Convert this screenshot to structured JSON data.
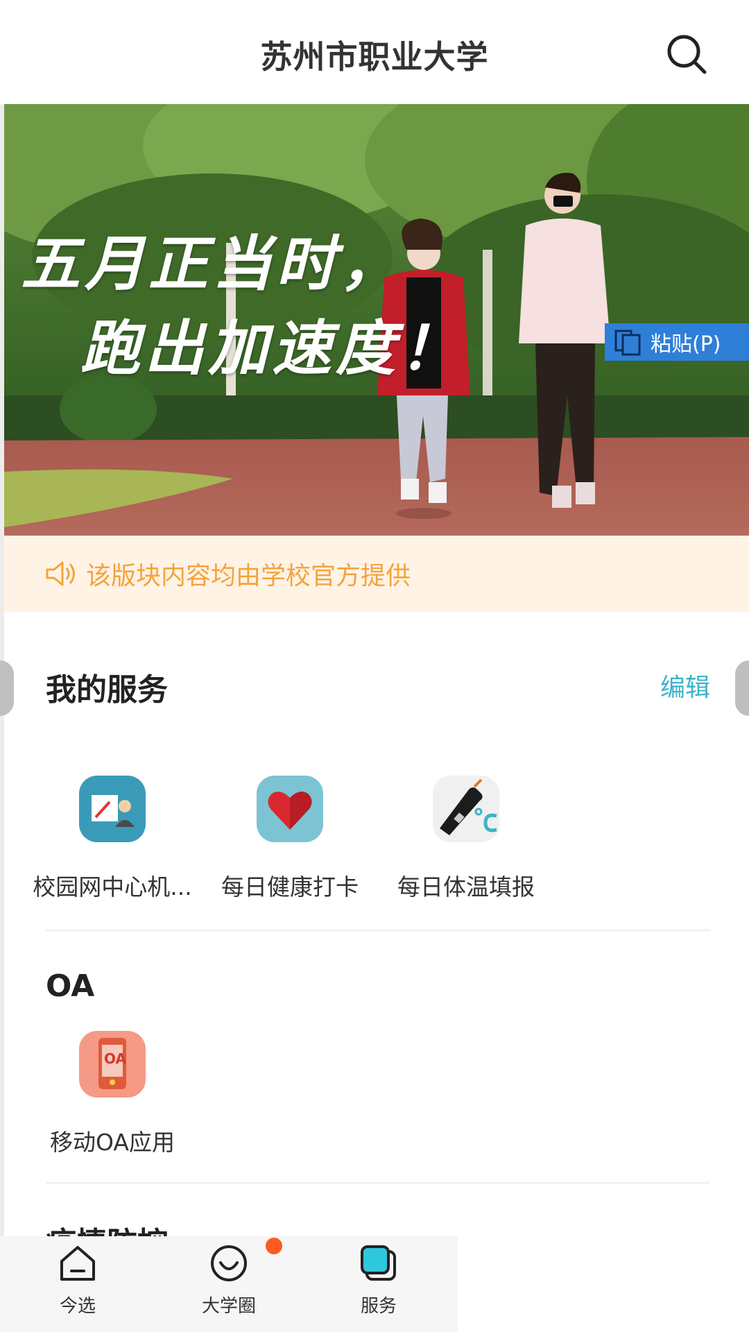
{
  "header": {
    "title": "苏州市职业大学",
    "search_icon": "search-icon"
  },
  "banner": {
    "slogan_line1": "五月正当时，",
    "slogan_line2": "跑出加速度！",
    "paste_label": "粘贴(P)"
  },
  "notice": {
    "icon": "speaker-icon",
    "text": "该版块内容均由学校官方提供"
  },
  "my_services": {
    "title": "我的服务",
    "edit_label": "编辑",
    "items": [
      {
        "label": "校园网中心机...",
        "icon": "campus-network-icon"
      },
      {
        "label": "每日健康打卡",
        "icon": "heart-icon"
      },
      {
        "label": "每日体温填报",
        "icon": "thermometer-icon"
      }
    ]
  },
  "oa": {
    "title": "OA",
    "items": [
      {
        "label": "移动OA应用",
        "icon": "mobile-oa-icon",
        "icon_text": "OA"
      }
    ]
  },
  "next_section": {
    "title": "疫情防控"
  },
  "tabbar": {
    "items": [
      {
        "label": "今选",
        "icon": "home-icon"
      },
      {
        "label": "大学圈",
        "icon": "smile-icon",
        "badge": true
      },
      {
        "label": "服务",
        "icon": "service-icon"
      }
    ]
  },
  "colors": {
    "accent": "#3cb3c7",
    "notice_text": "#f5a33a",
    "notice_bg": "#fff3e6",
    "badge": "#ff5a1f",
    "paste_bg": "#2f7fd8"
  }
}
